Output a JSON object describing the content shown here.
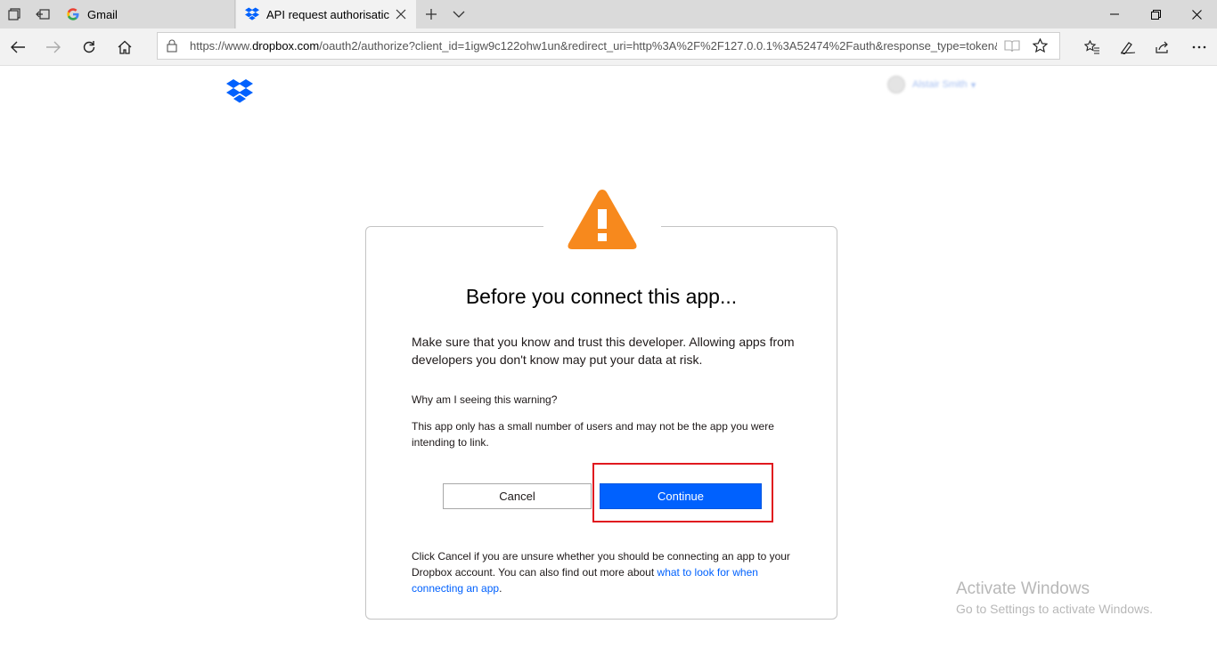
{
  "browser": {
    "tabs": [
      {
        "label": "Gmail"
      },
      {
        "label": "API request authorisatic"
      }
    ],
    "url_prefix": "https://www.",
    "url_domain": "dropbox.com",
    "url_rest": "/oauth2/authorize?client_id=1igw9c122ohw1un&redirect_uri=http%3A%2F%2F127.0.0.1%3A52474%2Fauth&response_type=token&"
  },
  "account": {
    "name": "Alstair Smith"
  },
  "dialog": {
    "title": "Before you connect this app...",
    "intro": "Make sure that you know and trust this developer. Allowing apps from developers you don't know may put your data at risk.",
    "why_heading": "Why am I seeing this warning?",
    "why_text": "This app only has a small number of users and may not be the app you were intending to link.",
    "cancel_label": "Cancel",
    "continue_label": "Continue",
    "footer_text": "Click Cancel if you are unsure whether you should be connecting an app to your Dropbox account. You can also find out more about ",
    "footer_link": "what to look for when connecting an app",
    "footer_end": "."
  },
  "watermark": {
    "line1": "Activate Windows",
    "line2": "Go to Settings to activate Windows."
  },
  "colors": {
    "accent": "#0061fe",
    "warning": "#f7891d",
    "highlight": "#e0191f"
  }
}
